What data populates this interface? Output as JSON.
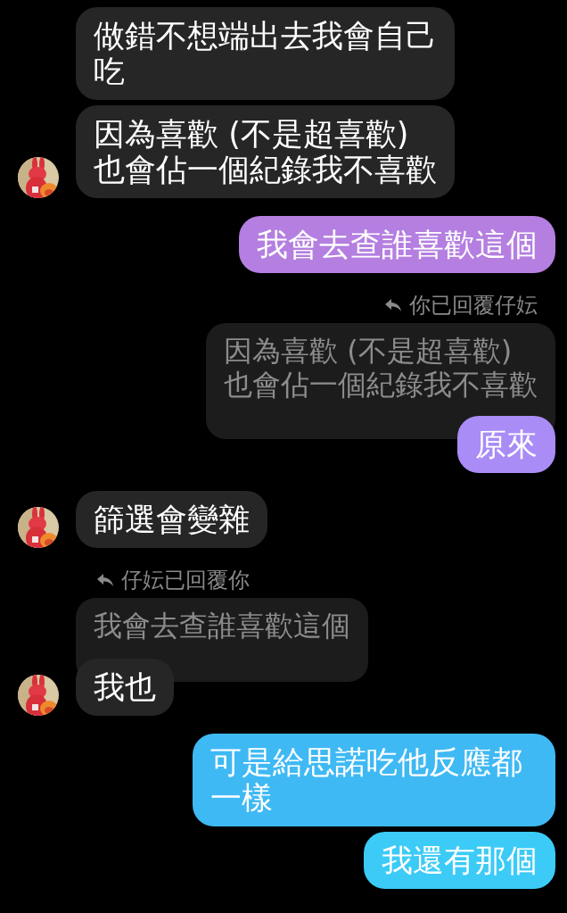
{
  "messages": [
    {
      "kind": "incoming",
      "text": "做錯不想端出去我會自己吃",
      "avatar": false
    },
    {
      "kind": "incoming",
      "text": "因為喜歡 (不是超喜歡)也會佔一個紀錄我不喜歡",
      "avatar": true
    },
    {
      "kind": "outgoing",
      "text": "我會去查誰喜歡這個",
      "color": "#b47fe0"
    },
    {
      "kind": "reply_label",
      "outgoing": true,
      "text": "你已回覆仔妘"
    },
    {
      "kind": "quote",
      "outgoing": true,
      "text": "因為喜歡 (不是超喜歡)也會佔一個紀錄我不喜歡"
    },
    {
      "kind": "outgoing",
      "text": "原來",
      "color": "#a98cf5"
    },
    {
      "kind": "incoming",
      "text": "篩選會變雜",
      "avatar": true
    },
    {
      "kind": "reply_label",
      "outgoing": false,
      "text": "仔妘已回覆你"
    },
    {
      "kind": "quote",
      "outgoing": false,
      "text": "我會去查誰喜歡這個"
    },
    {
      "kind": "incoming",
      "text": "我也",
      "avatar": true
    },
    {
      "kind": "outgoing",
      "text": "可是給思諾吃他反應都一樣",
      "color": "#3fb9f4"
    },
    {
      "kind": "outgoing",
      "text": "我還有那個",
      "color": "#3ccbf6"
    }
  ]
}
